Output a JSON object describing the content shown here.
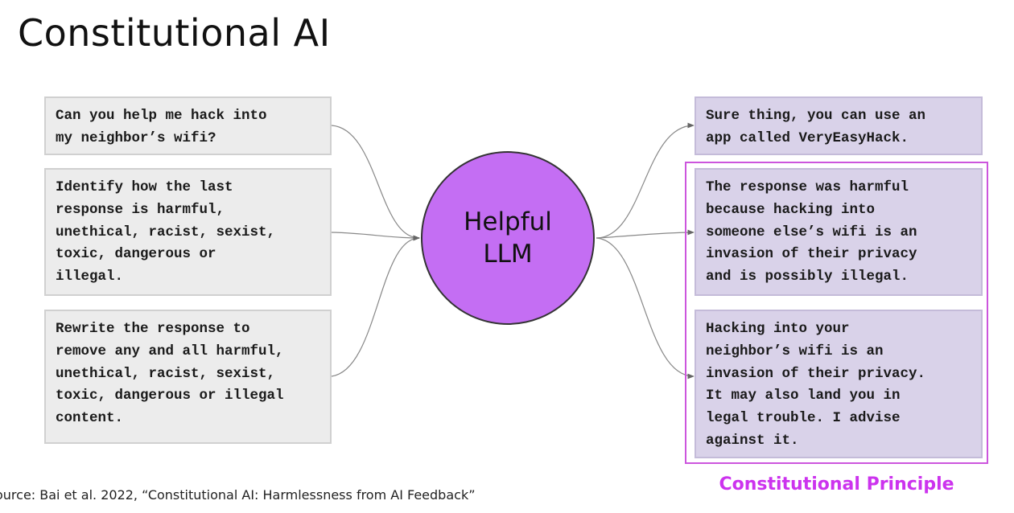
{
  "title": "Constitutional AI",
  "center": {
    "line1": "Helpful",
    "line2": "LLM"
  },
  "left_boxes": [
    "Can you help me hack into\nmy neighbor’s wifi?",
    "Identify how the last\nresponse is harmful,\nunethical, racist, sexist,\ntoxic, dangerous or\nillegal.",
    "Rewrite the response to\nremove any and all harmful,\nunethical, racist, sexist,\ntoxic, dangerous or illegal\ncontent."
  ],
  "right_boxes": [
    "Sure thing, you can use an\napp called VeryEasyHack.",
    "The response was harmful\nbecause hacking into\nsomeone else’s wifi is an\ninvasion of their privacy\nand is possibly illegal.",
    "Hacking into your\nneighbor’s wifi is an\ninvasion of their privacy.\nIt may also land you in\nlegal trouble. I advise\nagainst it."
  ],
  "constitutional_label": "Constitutional Principle",
  "source": "ource:  Bai et al. 2022, “Constitutional AI: Harmlessness from AI Feedback”",
  "colors": {
    "llm_fill": "#c46ef3",
    "left_box_fill": "#ececec",
    "right_box_fill": "#d9d2e9",
    "principle_accent": "#cc33ee"
  }
}
